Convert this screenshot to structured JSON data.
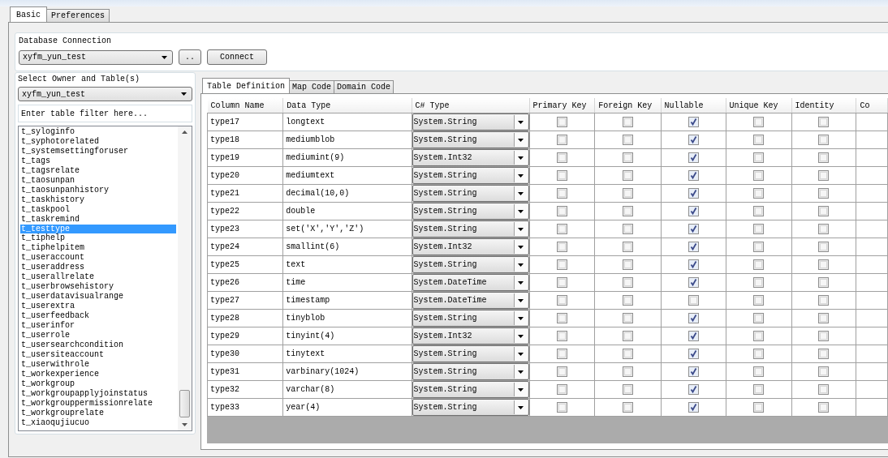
{
  "tabs": [
    {
      "label": "Basic",
      "selected": true
    },
    {
      "label": "Preferences",
      "selected": false
    }
  ],
  "database_connection": {
    "label": "Database Connection",
    "value": "xyfm_yun_test",
    "browse_button": "..",
    "connect_button": "Connect"
  },
  "owner_table": {
    "label": "Select Owner and Table(s)",
    "owner": "xyfm_yun_test",
    "filter_placeholder": "Enter table filter here...",
    "tables": [
      {
        "name": "t_syloginfo",
        "selected": false
      },
      {
        "name": "t_syphotorelated",
        "selected": false
      },
      {
        "name": "t_systemsettingforuser",
        "selected": false
      },
      {
        "name": "t_tags",
        "selected": false
      },
      {
        "name": "t_tagsrelate",
        "selected": false
      },
      {
        "name": "t_taosunpan",
        "selected": false
      },
      {
        "name": "t_taosunpanhistory",
        "selected": false
      },
      {
        "name": "t_taskhistory",
        "selected": false
      },
      {
        "name": "t_taskpool",
        "selected": false
      },
      {
        "name": "t_taskremind",
        "selected": false
      },
      {
        "name": "t_testtype",
        "selected": true
      },
      {
        "name": "t_tiphelp",
        "selected": false
      },
      {
        "name": "t_tiphelpitem",
        "selected": false
      },
      {
        "name": "t_useraccount",
        "selected": false
      },
      {
        "name": "t_useraddress",
        "selected": false
      },
      {
        "name": "t_userallrelate",
        "selected": false
      },
      {
        "name": "t_userbrowsehistory",
        "selected": false
      },
      {
        "name": "t_userdatavisualrange",
        "selected": false
      },
      {
        "name": "t_userextra",
        "selected": false
      },
      {
        "name": "t_userfeedback",
        "selected": false
      },
      {
        "name": "t_userinfor",
        "selected": false
      },
      {
        "name": "t_userrole",
        "selected": false
      },
      {
        "name": "t_usersearchcondition",
        "selected": false
      },
      {
        "name": "t_usersiteaccount",
        "selected": false
      },
      {
        "name": "t_userwithrole",
        "selected": false
      },
      {
        "name": "t_workexperience",
        "selected": false
      },
      {
        "name": "t_workgroup",
        "selected": false
      },
      {
        "name": "t_workgroupapplyjoinstatus",
        "selected": false
      },
      {
        "name": "t_workgrouppermissionrelate",
        "selected": false
      },
      {
        "name": "t_workgrouprelate",
        "selected": false
      },
      {
        "name": "t_xiaoqujiucuo",
        "selected": false
      }
    ]
  },
  "detail_tabs": [
    {
      "label": "Table Definition",
      "selected": true
    },
    {
      "label": "Map Code",
      "selected": false
    },
    {
      "label": "Domain Code",
      "selected": false
    }
  ],
  "table": {
    "columns": [
      "Column Name",
      "Data Type",
      "C# Type",
      "Primary Key",
      "Foreign Key",
      "Nullable",
      "Unique Key",
      "Identity",
      "Co"
    ],
    "rows": [
      {
        "column_name": "type17",
        "data_type": "longtext",
        "csharp_type": "System.String",
        "primary_key": false,
        "foreign_key": false,
        "nullable": true,
        "unique_key": false,
        "identity": false
      },
      {
        "column_name": "type18",
        "data_type": "mediumblob",
        "csharp_type": "System.String",
        "primary_key": false,
        "foreign_key": false,
        "nullable": true,
        "unique_key": false,
        "identity": false
      },
      {
        "column_name": "type19",
        "data_type": "mediumint(9)",
        "csharp_type": "System.Int32",
        "primary_key": false,
        "foreign_key": false,
        "nullable": true,
        "unique_key": false,
        "identity": false
      },
      {
        "column_name": "type20",
        "data_type": "mediumtext",
        "csharp_type": "System.String",
        "primary_key": false,
        "foreign_key": false,
        "nullable": true,
        "unique_key": false,
        "identity": false
      },
      {
        "column_name": "type21",
        "data_type": "decimal(10,0)",
        "csharp_type": "System.String",
        "primary_key": false,
        "foreign_key": false,
        "nullable": true,
        "unique_key": false,
        "identity": false
      },
      {
        "column_name": "type22",
        "data_type": "double",
        "csharp_type": "System.String",
        "primary_key": false,
        "foreign_key": false,
        "nullable": true,
        "unique_key": false,
        "identity": false
      },
      {
        "column_name": "type23",
        "data_type": "set('X','Y','Z')",
        "csharp_type": "System.String",
        "primary_key": false,
        "foreign_key": false,
        "nullable": true,
        "unique_key": false,
        "identity": false
      },
      {
        "column_name": "type24",
        "data_type": "smallint(6)",
        "csharp_type": "System.Int32",
        "primary_key": false,
        "foreign_key": false,
        "nullable": true,
        "unique_key": false,
        "identity": false
      },
      {
        "column_name": "type25",
        "data_type": "text",
        "csharp_type": "System.String",
        "primary_key": false,
        "foreign_key": false,
        "nullable": true,
        "unique_key": false,
        "identity": false
      },
      {
        "column_name": "type26",
        "data_type": "time",
        "csharp_type": "System.DateTime",
        "primary_key": false,
        "foreign_key": false,
        "nullable": true,
        "unique_key": false,
        "identity": false
      },
      {
        "column_name": "type27",
        "data_type": "timestamp",
        "csharp_type": "System.DateTime",
        "primary_key": false,
        "foreign_key": false,
        "nullable": false,
        "unique_key": false,
        "identity": false
      },
      {
        "column_name": "type28",
        "data_type": "tinyblob",
        "csharp_type": "System.String",
        "primary_key": false,
        "foreign_key": false,
        "nullable": true,
        "unique_key": false,
        "identity": false
      },
      {
        "column_name": "type29",
        "data_type": "tinyint(4)",
        "csharp_type": "System.Int32",
        "primary_key": false,
        "foreign_key": false,
        "nullable": true,
        "unique_key": false,
        "identity": false
      },
      {
        "column_name": "type30",
        "data_type": "tinytext",
        "csharp_type": "System.String",
        "primary_key": false,
        "foreign_key": false,
        "nullable": true,
        "unique_key": false,
        "identity": false
      },
      {
        "column_name": "type31",
        "data_type": "varbinary(1024)",
        "csharp_type": "System.String",
        "primary_key": false,
        "foreign_key": false,
        "nullable": true,
        "unique_key": false,
        "identity": false
      },
      {
        "column_name": "type32",
        "data_type": "varchar(8)",
        "csharp_type": "System.String",
        "primary_key": false,
        "foreign_key": false,
        "nullable": true,
        "unique_key": false,
        "identity": false
      },
      {
        "column_name": "type33",
        "data_type": "year(4)",
        "csharp_type": "System.String",
        "primary_key": false,
        "foreign_key": false,
        "nullable": true,
        "unique_key": false,
        "identity": false
      }
    ]
  }
}
